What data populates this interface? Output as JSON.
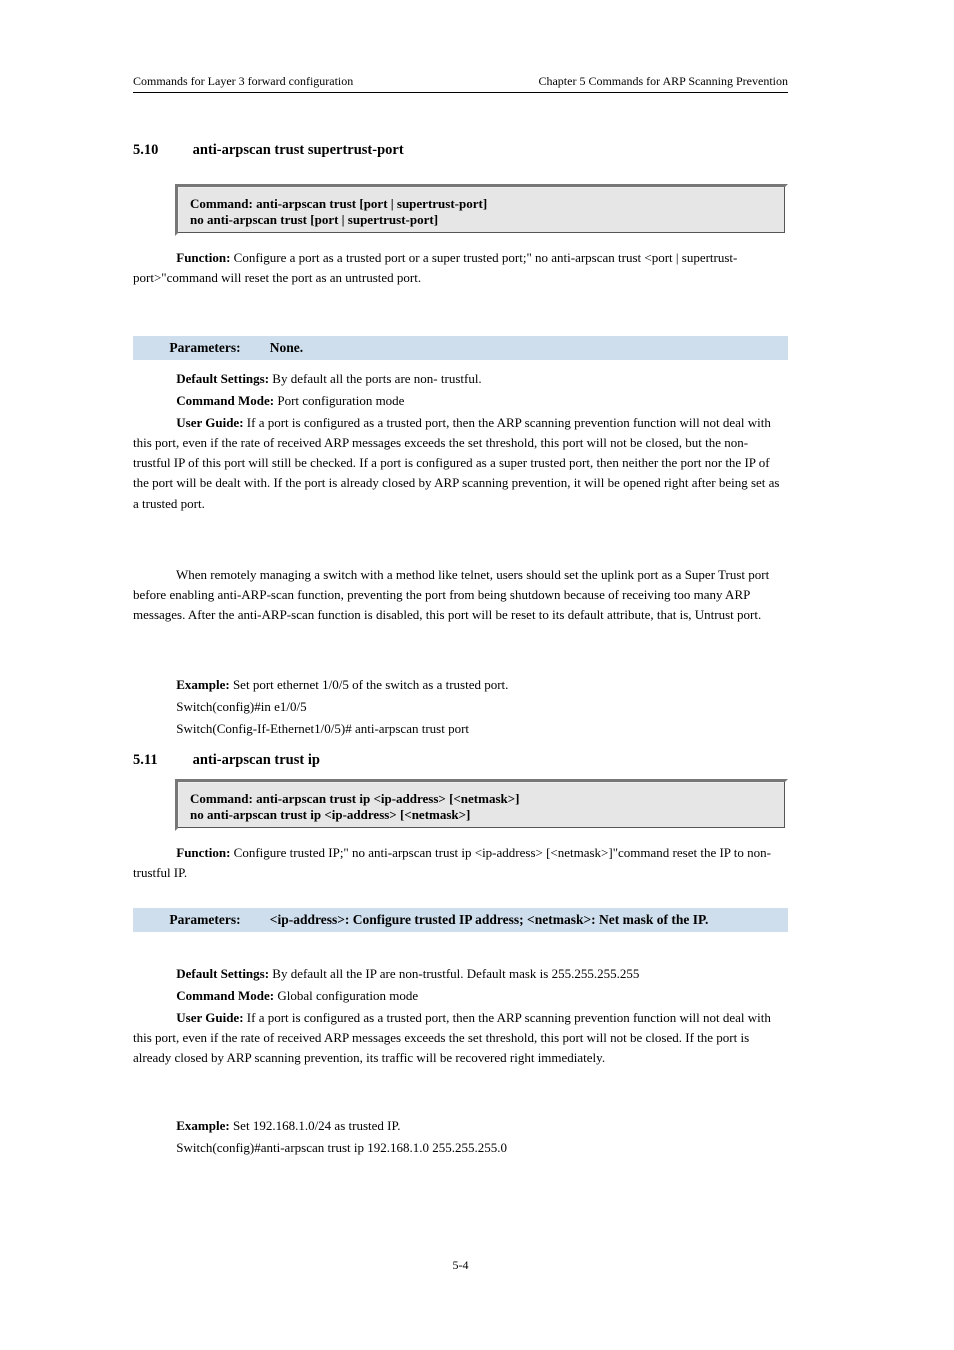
{
  "header": {
    "left": "Commands for Layer 3 forward configuration",
    "right": "Chapter 5 Commands for ARP Scanning Prevention"
  },
  "section1": {
    "num": "5.10",
    "title": "anti-arpscan trust supertrust-port",
    "commandBlock": "Command: anti-arpscan trust [port | supertrust-port]\n    no anti-arpscan trust [port | supertrust-port]",
    "function": {
      "label": "Function:",
      "text": "Configure a port as a trusted port or a super trusted port;\" no anti-arpscan trust <port | supertrust-port>\"command will reset the port as an untrusted port."
    },
    "parametersBand": {
      "lead": "Parameters:",
      "rest": "None."
    },
    "defaultSettings": {
      "label": "Default Settings:",
      "text": "By default all the ports are non- trustful."
    },
    "commandMode": {
      "label": "Command Mode:",
      "text": "Port configuration mode"
    },
    "userGuide": {
      "label": "User Guide:",
      "text": "If a port is configured as a trusted port, then the ARP scanning prevention function will not deal with this port, even if the rate of received ARP messages exceeds the set threshold, this port will not be closed, but the non- trustful IP of this port will still be checked. If a port is configured as a super trusted port, then neither the port nor the IP of the port will be dealt with. If the port is already closed by ARP scanning prevention, it will be opened right after being set as a trusted port."
    },
    "dhcpNote": "When remotely managing a switch with a method like telnet, users should set the uplink port as a Super Trust port before enabling anti-ARP-scan function, preventing the port from being shutdown because of receiving too many ARP messages. After the anti-ARP-scan function is disabled, this port will be reset to its default attribute, that is, Untrust port.",
    "example": {
      "label": "Example:",
      "text": "Set port ethernet 1/0/5 of the switch as a trusted port."
    },
    "exLine1": "Switch(config)#in e1/0/5",
    "exLine2": "Switch(Config-If-Ethernet1/0/5)# anti-arpscan trust port"
  },
  "section2": {
    "num": "5.11",
    "title": "anti-arpscan trust ip",
    "commandBlock": "Command: anti-arpscan trust ip <ip-address> [<netmask>]\n    no anti-arpscan trust ip <ip-address> [<netmask>]",
    "function": {
      "label": "Function:",
      "text": "Configure trusted IP;\" no anti-arpscan trust ip <ip-address> [<netmask>]\"command reset the IP to non-trustful IP."
    },
    "parametersBand": {
      "lead": "Parameters:",
      "rest": "<ip-address>: Configure trusted IP address; <netmask>: Net mask of the IP."
    },
    "param1": {
      "name": "<ip-address>:",
      "desc": "Configure trusted IP address;"
    },
    "param2": {
      "name": "<netmask>:",
      "desc": "Net mask of the IP."
    },
    "defaultSettings": {
      "label": "Default Settings:",
      "text": "By default all the IP are non-trustful. Default mask is 255.255.255.255"
    },
    "commandMode": {
      "label": "Command Mode:",
      "text": "Global configuration mode"
    },
    "userGuide": {
      "label": "User Guide:",
      "text": "If a port is configured as a trusted port, then the ARP scanning prevention function will not deal with this port, even if the rate of received ARP messages exceeds the set threshold, this port will not be closed. If the port is already closed by ARP scanning prevention, its traffic will be recovered right immediately."
    },
    "example": {
      "label": "Example:",
      "text": "Set 192.168.1.0/24 as trusted IP."
    },
    "exLine1": "Switch(config)#anti-arpscan trust ip 192.168.1.0 255.255.255.0"
  },
  "footer": {
    "left": "",
    "page": "5-4"
  }
}
